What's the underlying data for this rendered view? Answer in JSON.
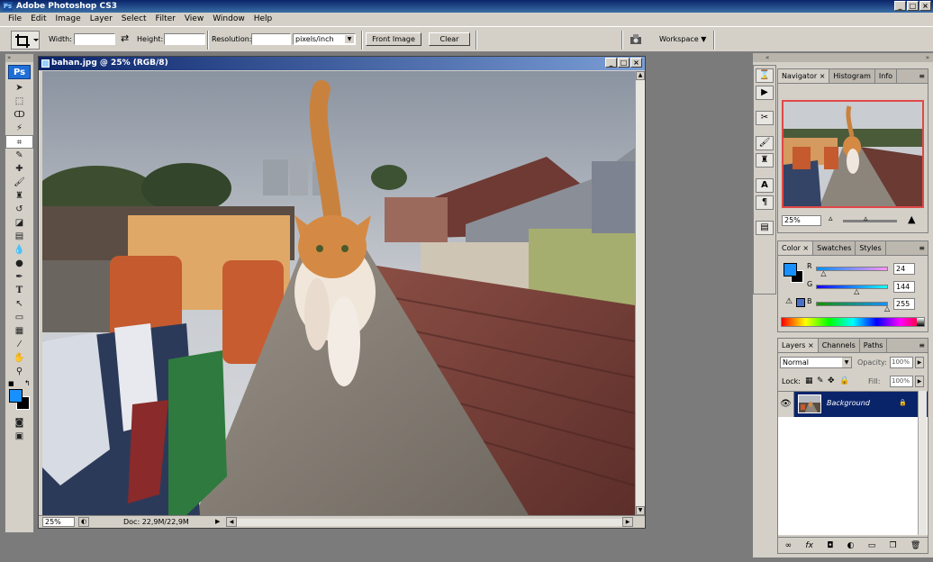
{
  "app": {
    "title": "Adobe Photoshop CS3",
    "logo": "Ps"
  },
  "window_buttons": [
    "_",
    "□",
    "×"
  ],
  "menu": [
    "File",
    "Edit",
    "Image",
    "Layer",
    "Select",
    "Filter",
    "View",
    "Window",
    "Help"
  ],
  "options": {
    "width_label": "Width:",
    "height_label": "Height:",
    "resolution_label": "Resolution:",
    "units": "pixels/inch",
    "front_image": "Front Image",
    "clear": "Clear",
    "workspace": "Workspace ▼",
    "swap_icon": "⇄"
  },
  "document": {
    "title": "bahan.jpg @ 25% (RGB/8)",
    "zoom": "25%",
    "doc_info": "Doc: 22,9M/22,9M"
  },
  "navigator": {
    "tabs": [
      "Navigator ×",
      "Histogram",
      "Info"
    ],
    "zoom": "25%",
    "zoom_position": 0.45
  },
  "color": {
    "tabs": [
      "Color ×",
      "Swatches",
      "Styles"
    ],
    "r_label": "R",
    "g_label": "G",
    "b_label": "B",
    "r": "24",
    "g": "144",
    "b": "255",
    "r_fraction": 0.094,
    "g_fraction": 0.565,
    "b_fraction": 1.0,
    "foreground": "#1890ff"
  },
  "layers": {
    "tabs": [
      "Layers ×",
      "Channels",
      "Paths"
    ],
    "blend_mode": "Normal",
    "opacity_label": "Opacity:",
    "opacity": "100%",
    "lock_label": "Lock:",
    "fill_label": "Fill:",
    "fill": "100%",
    "layer_name": "Background"
  },
  "colors": {
    "accent": "#0a246a",
    "foreground": "#1890ff",
    "background": "#000000"
  }
}
